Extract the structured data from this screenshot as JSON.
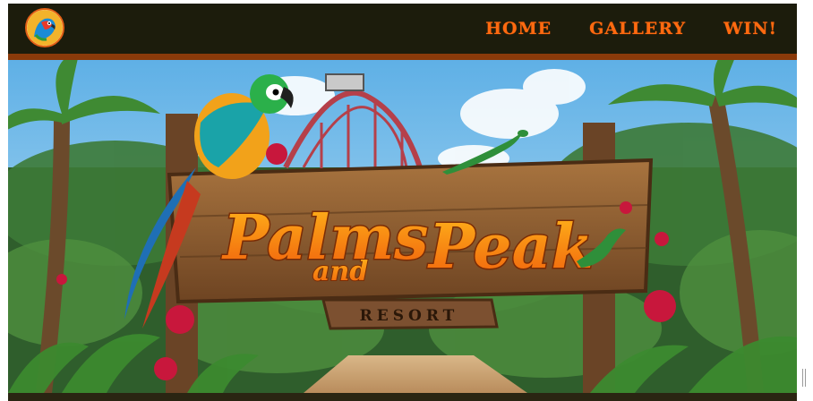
{
  "nav": {
    "logo_alt": "parrot logo",
    "items": [
      {
        "label": "HOME"
      },
      {
        "label": "GALLERY"
      },
      {
        "label": "WIN!"
      }
    ]
  },
  "hero": {
    "sign_line1": "Palms",
    "sign_line2": "Peak",
    "sign_connector": "and",
    "sign_plaque": "RESORT",
    "icons": [
      "parrot-icon",
      "lizard-icon",
      "roller-coaster-icon",
      "palm-tree-icon",
      "hibiscus-flower-icon"
    ]
  },
  "colors": {
    "navbar_bg": "#1c1c0c",
    "nav_link": "#ff6a10",
    "sign_wood": "#8a5a33",
    "sign_text": "#ff8a12",
    "sky": "#7ec1ea",
    "jungle": "#2f5e2c"
  }
}
